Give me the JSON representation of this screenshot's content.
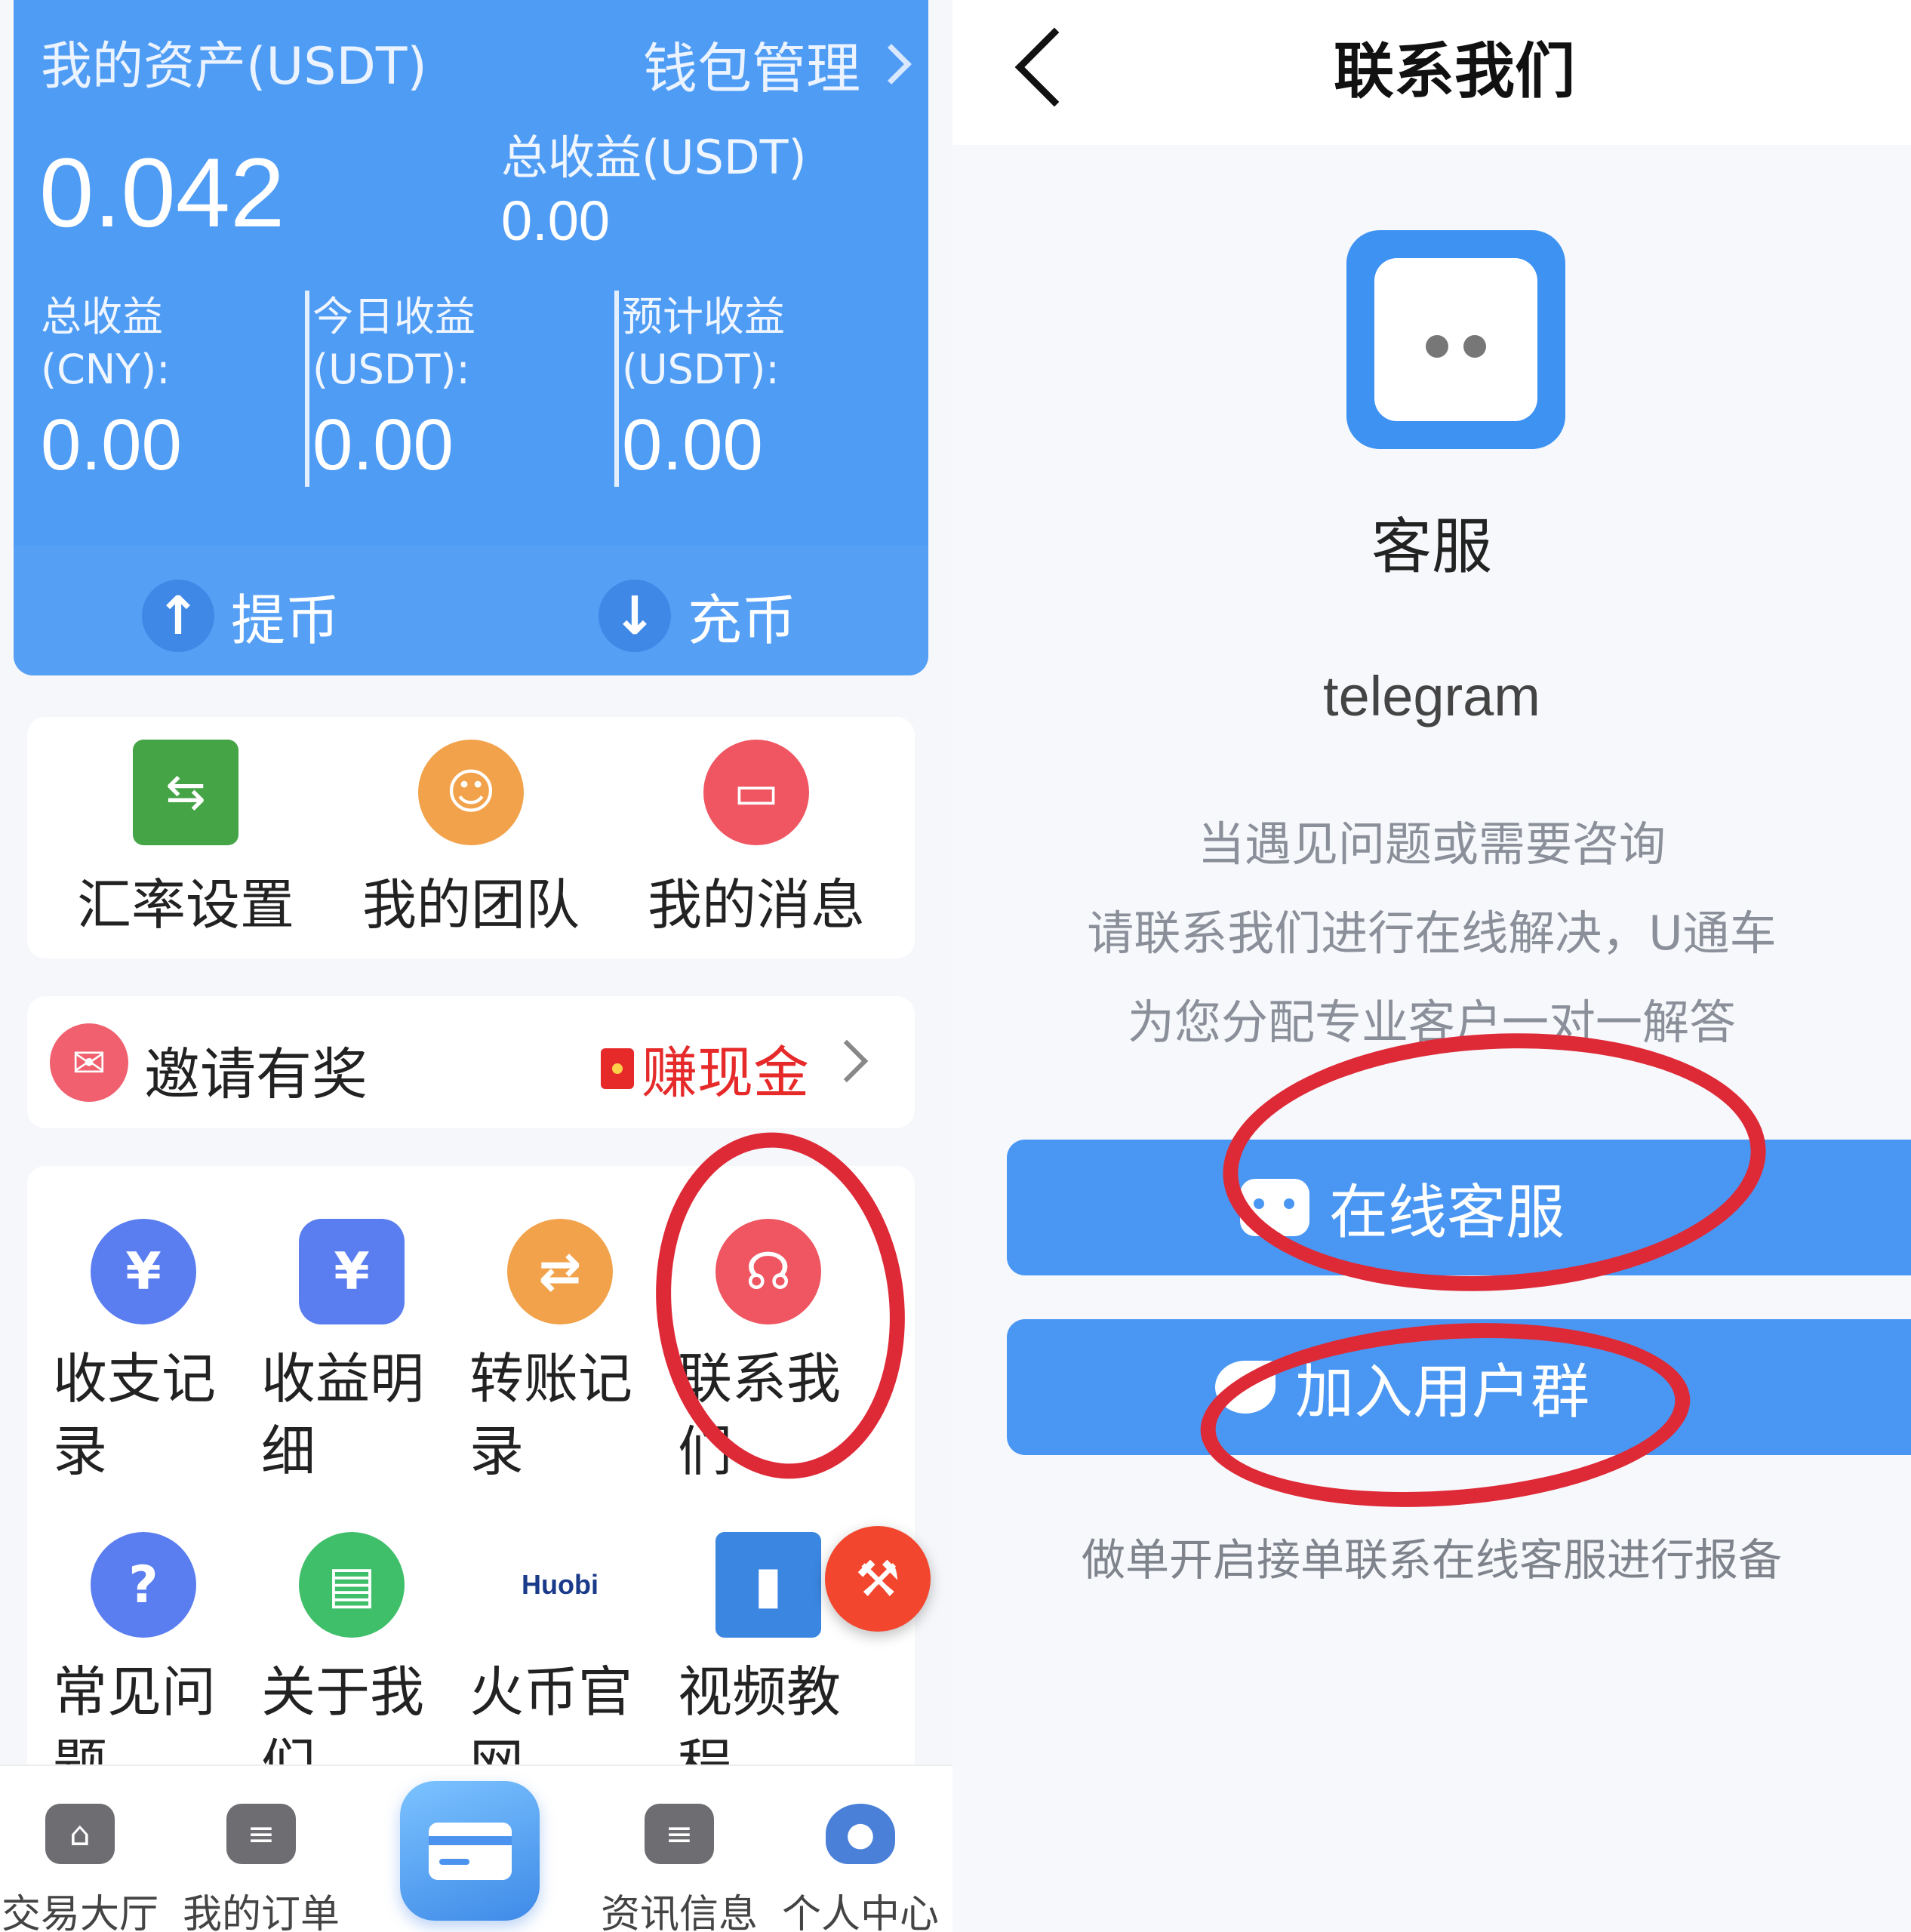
{
  "assets": {
    "title": "我的资产(USDT)",
    "wallet_link": "钱包管理",
    "balance": "0.042",
    "total_income_label": "总收益(USDT)",
    "total_income_value": "0.00",
    "stats": [
      {
        "label1": "总收益",
        "label2": "(CNY):",
        "value": "0.00"
      },
      {
        "label1": "今日收益",
        "label2": "(USDT):",
        "value": "0.00"
      },
      {
        "label1": "预计收益",
        "label2": "(USDT):",
        "value": "0.00"
      }
    ],
    "withdraw": "提币",
    "deposit": "充币"
  },
  "quick": [
    {
      "label": "汇率设置",
      "color": "#44a446",
      "icon": "exchange-icon"
    },
    {
      "label": "我的团队",
      "color": "#f2a24a",
      "icon": "team-icon"
    },
    {
      "label": "我的消息",
      "color": "#ef5662",
      "icon": "message-icon"
    }
  ],
  "invite": {
    "label": "邀请有奖",
    "earn": "赚现金"
  },
  "grid": [
    {
      "label": "收支记录",
      "color": "#5a7ef0",
      "glyph": "¥",
      "icon": "records-icon"
    },
    {
      "label": "收益明细",
      "color": "#5a7ef0",
      "glyph": "¥",
      "icon": "income-detail-icon"
    },
    {
      "label": "转账记录",
      "color": "#f2a24a",
      "glyph": "⇄",
      "icon": "transfer-icon"
    },
    {
      "label": "联系我们",
      "color": "#ef5662",
      "glyph": "☊",
      "icon": "headset-icon"
    },
    {
      "label": "常见问题",
      "color": "#5a7ef0",
      "glyph": "?",
      "icon": "faq-icon"
    },
    {
      "label": "关于我们",
      "color": "#3fbf6a",
      "glyph": "▤",
      "icon": "about-icon"
    },
    {
      "label": "火币官网",
      "color": "#ffffff",
      "glyph": "Huobi",
      "icon": "huobi-logo-icon"
    },
    {
      "label": "视频教程",
      "color": "#3a86e0",
      "glyph": "▮",
      "icon": "video-tutorial-icon"
    }
  ],
  "tabs": [
    {
      "label": "交易大厅",
      "icon": "home-icon"
    },
    {
      "label": "我的订单",
      "icon": "orders-icon"
    },
    {
      "label": "资讯信息",
      "icon": "news-icon"
    },
    {
      "label": "个人中心",
      "icon": "profile-icon"
    }
  ],
  "contact": {
    "title": "联系我们",
    "service_name": "客服",
    "channel": "telegram",
    "desc_lines": [
      "当遇见问题或需要咨询",
      "请联系我们进行在线解决，U通车",
      "为您分配专业客户一对一解答"
    ],
    "online_btn": "在线客服",
    "group_btn": "加入用户群",
    "note": "做单开启接单联系在线客服进行报备"
  },
  "colors": {
    "primary": "#4f9cf5",
    "accent_red": "#e62a2a",
    "annotation": "#de2a37"
  }
}
